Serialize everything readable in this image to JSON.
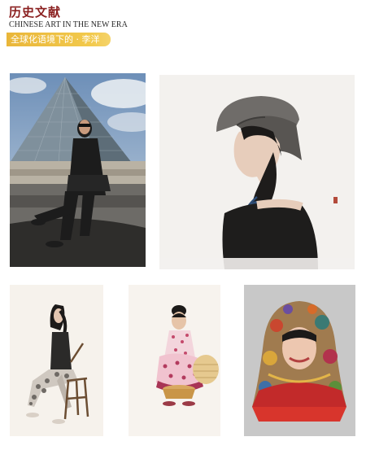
{
  "header": {
    "title": "历史文献",
    "subtitle_en": "CHINESE ART IN THE NEW ERA",
    "tag": "全球化语境下的 · 李洋"
  },
  "colors": {
    "title": "#8a1f1f",
    "tag_background": "#f2c94c",
    "tag_text": "#ffffff"
  }
}
